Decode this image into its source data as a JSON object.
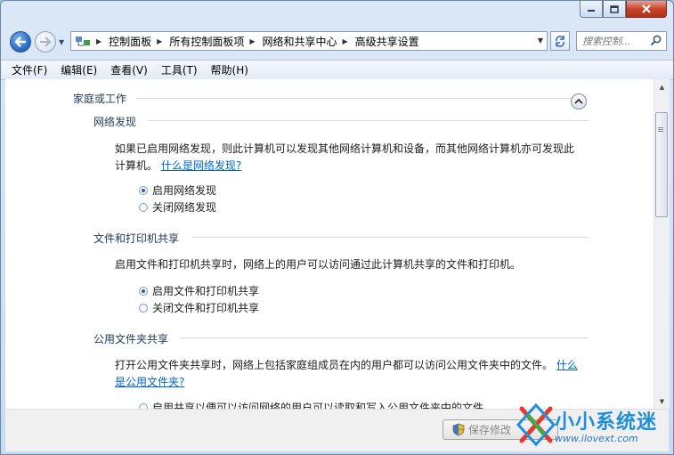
{
  "nav": {
    "breadcrumbs": [
      "控制面板",
      "所有控制面板项",
      "网络和共享中心",
      "高级共享设置"
    ],
    "search_placeholder": "搜索控制..."
  },
  "menu": [
    "文件(F)",
    "编辑(E)",
    "查看(V)",
    "工具(T)",
    "帮助(H)"
  ],
  "group": {
    "title": "家庭或工作"
  },
  "sections": {
    "discovery": {
      "title": "网络发现",
      "desc": "如果已启用网络发现，则此计算机可以发现其他网络计算机和设备，而其他网络计算机亦可发现此计算机。",
      "link": "什么是网络发现?",
      "options": [
        "启用网络发现",
        "关闭网络发现"
      ],
      "selected": 0
    },
    "printer": {
      "title": "文件和打印机共享",
      "desc": "启用文件和打印机共享时，网络上的用户可以访问通过此计算机共享的文件和打印机。",
      "options": [
        "启用文件和打印机共享",
        "关闭文件和打印机共享"
      ],
      "selected": 0
    },
    "public": {
      "title": "公用文件夹共享",
      "desc": "打开公用文件夹共享时，网络上包括家庭组成员在内的用户都可以访问公用文件夹中的文件。",
      "link1": "什么",
      "link2": "是公用文件夹?",
      "option_partial": "启用共享以便可以访问网络的用户可以读取和写入公用文件夹中的文件"
    }
  },
  "footer": {
    "save_label": "保存修改"
  },
  "watermark": {
    "line1": "小小系统迷",
    "line2": "www.ilovext.com"
  },
  "colors": {
    "link": "#0066cc",
    "section_title": "#1e3955",
    "close_button": "#c8442c"
  }
}
